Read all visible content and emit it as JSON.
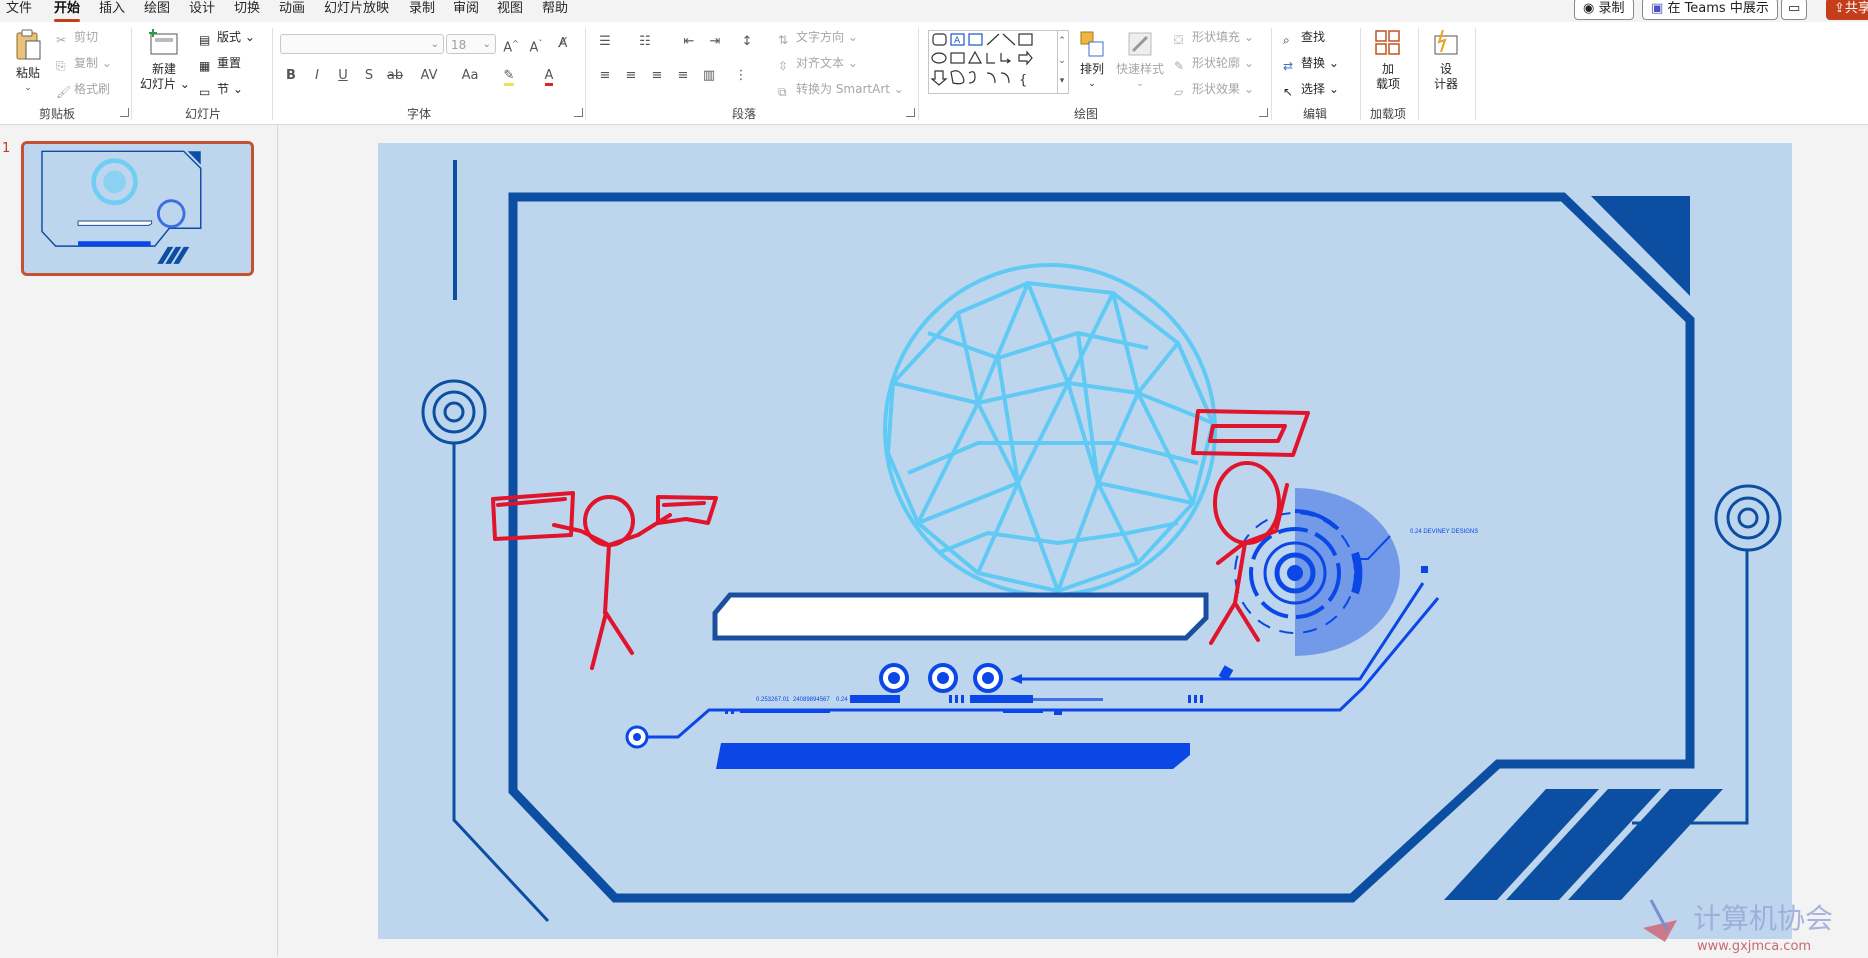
{
  "menu": {
    "items": [
      "文件",
      "开始",
      "插入",
      "绘图",
      "设计",
      "切换",
      "动画",
      "幻灯片放映",
      "录制",
      "审阅",
      "视图",
      "帮助"
    ],
    "active": "开始",
    "record_button": "录制",
    "teams_button": "在 Teams 中展示",
    "share_button": "共享"
  },
  "ribbon": {
    "clipboard": {
      "paste": "粘贴",
      "cut": "剪切",
      "copy": "复制",
      "format_painter": "格式刷",
      "label": "剪贴板"
    },
    "slides": {
      "new_slide_line1": "新建",
      "new_slide_line2": "幻灯片",
      "layout": "版式",
      "reset": "重置",
      "section": "节",
      "label": "幻灯片"
    },
    "font": {
      "font_name": "",
      "font_size": "18",
      "bold": "B",
      "italic": "I",
      "underline": "U",
      "shadow": "S",
      "strike": "ab",
      "spacing": "AV",
      "case": "Aa",
      "label": "字体"
    },
    "paragraph": {
      "text_direction": "文字方向",
      "align_text": "对齐文本",
      "smartart": "转换为 SmartArt",
      "label": "段落"
    },
    "drawing": {
      "arrange": "排列",
      "quick_styles": "快速样式",
      "shape_fill": "形状填充",
      "shape_outline": "形状轮廓",
      "shape_effects": "形状效果",
      "label": "绘图"
    },
    "editing": {
      "find": "查找",
      "replace": "替换",
      "select": "选择",
      "label": "编辑"
    },
    "addins": {
      "addins_line1": "加",
      "addins_line2": "载项",
      "label": "加载项"
    },
    "designer": {
      "line1": "设",
      "line2": "计器"
    }
  },
  "thumbnails": {
    "slide_number": "1"
  },
  "slide": {
    "hud_caption": "0.24 DEVINEY DESIGNS",
    "data_text_1": "0.253267.01",
    "data_text_2": "24089894567",
    "data_text_3": "0.24"
  },
  "watermark": {
    "title": "计算机协会",
    "url": "www.gxjmca.com"
  },
  "colors": {
    "accent": "#c43e1c",
    "slide_bg": "#bdd6ee",
    "frame_blue": "#0b4ea2",
    "bright_blue": "#0a47e6",
    "figure_red": "#e0142a",
    "sphere_cyan": "#5ccaf5"
  }
}
